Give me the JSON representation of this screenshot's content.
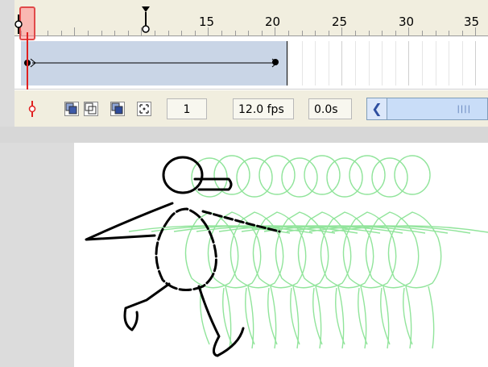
{
  "timeline": {
    "ruler_numbers": [
      "15",
      "20",
      "25",
      "30",
      "35"
    ],
    "current_frame": "1",
    "frame_rate": "12.0 fps",
    "elapsed_time": "0.0s"
  },
  "toolbar": {
    "buttons": [
      "center-frame",
      "onion-skin",
      "onion-skin-outlines",
      "edit-multiple-frames",
      "modify-onion-markers"
    ]
  },
  "colors": {
    "ruler_bg": "#f1eedf",
    "tween_fill": "#c9d5e6",
    "playhead": "#e02020",
    "onion_green": "#7ee08a",
    "stage_bg": "#ffffff"
  }
}
